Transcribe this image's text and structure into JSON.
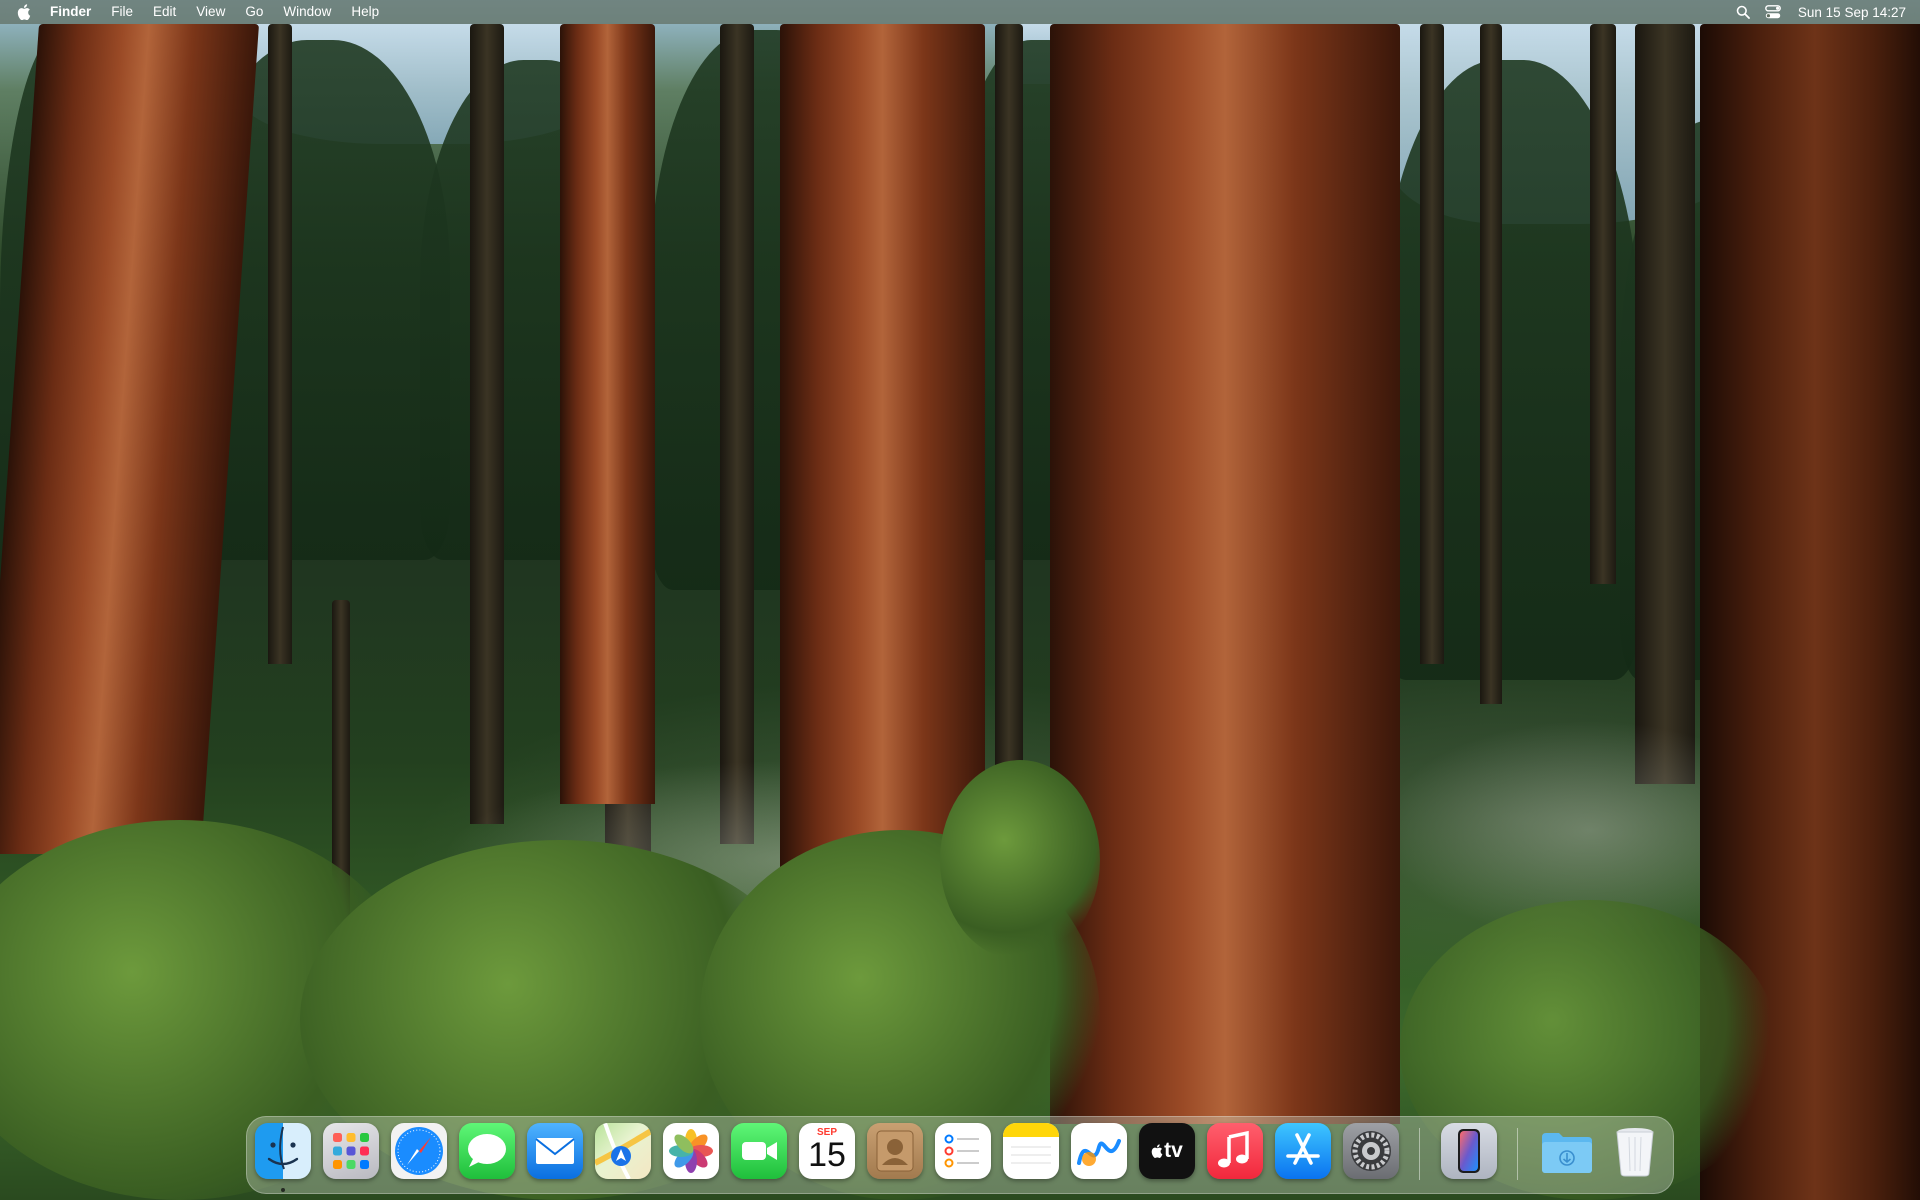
{
  "menubar": {
    "apple_icon": "apple-logo-icon",
    "app_name": "Finder",
    "menus": [
      "File",
      "Edit",
      "View",
      "Go",
      "Window",
      "Help"
    ],
    "status_icons": [
      "spotlight-search-icon",
      "control-center-icon"
    ],
    "clock": "Sun 15 Sep  14:27"
  },
  "dock": {
    "apps": [
      {
        "name": "Finder",
        "icon": "finder-icon",
        "running": true
      },
      {
        "name": "Launchpad",
        "icon": "launchpad-icon"
      },
      {
        "name": "Safari",
        "icon": "safari-compass-icon"
      },
      {
        "name": "Messages",
        "icon": "messages-bubble-icon"
      },
      {
        "name": "Mail",
        "icon": "mail-envelope-icon"
      },
      {
        "name": "Maps",
        "icon": "maps-icon"
      },
      {
        "name": "Photos",
        "icon": "photos-flower-icon"
      },
      {
        "name": "FaceTime",
        "icon": "facetime-camera-icon"
      },
      {
        "name": "Calendar",
        "icon": "calendar-icon",
        "month": "SEP",
        "day": "15"
      },
      {
        "name": "Contacts",
        "icon": "contacts-icon"
      },
      {
        "name": "Reminders",
        "icon": "reminders-list-icon"
      },
      {
        "name": "Notes",
        "icon": "notes-icon"
      },
      {
        "name": "Freeform",
        "icon": "freeform-icon"
      },
      {
        "name": "TV",
        "icon": "apple-tv-icon",
        "label": "tv"
      },
      {
        "name": "Music",
        "icon": "music-note-icon"
      },
      {
        "name": "App Store",
        "icon": "app-store-icon"
      },
      {
        "name": "System Settings",
        "icon": "gear-icon"
      },
      {
        "name": "iPhone Mirroring",
        "icon": "iphone-icon"
      },
      {
        "name": "Downloads",
        "icon": "downloads-folder-icon"
      },
      {
        "name": "Trash",
        "icon": "trash-icon"
      }
    ]
  },
  "colors": {
    "menubar_bg": "#5f6e5f",
    "dock_bg": "#cdd7c8",
    "safari_blue": "#1a8cff",
    "messages_green": "#34c759",
    "music_red": "#fc3c44"
  }
}
